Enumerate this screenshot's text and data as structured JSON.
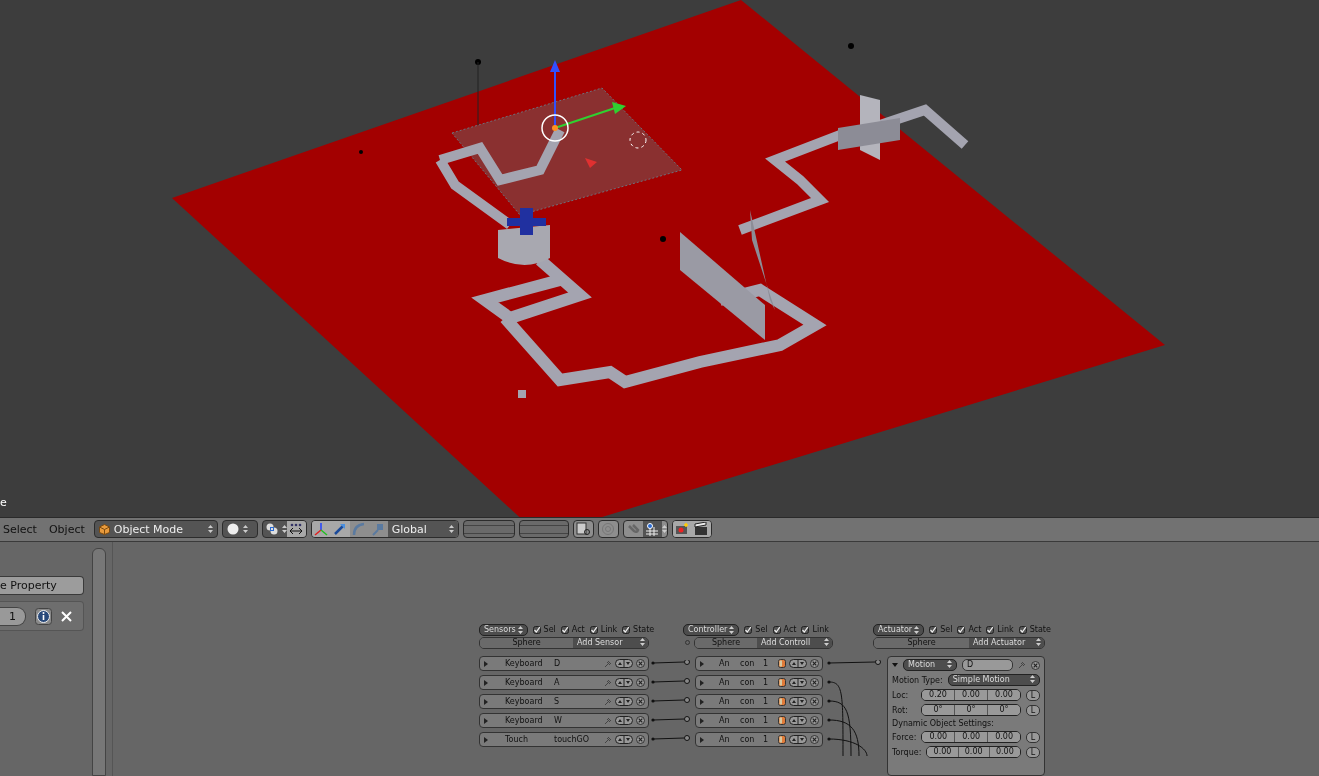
{
  "viewport": {
    "corner_text": "e"
  },
  "header": {
    "menus": [
      "Select",
      "Object"
    ],
    "mode": "Object Mode",
    "orientation": "Global"
  },
  "left_panel": {
    "button": "e Property",
    "field": "1"
  },
  "logic": {
    "sensors": {
      "menu": "Sensors",
      "filters": [
        {
          "label": "Sel",
          "checked": true
        },
        {
          "label": "Act",
          "checked": true
        },
        {
          "label": "Link",
          "checked": true
        },
        {
          "label": "State",
          "checked": true
        }
      ],
      "object": "Sphere",
      "add": "Add Sensor",
      "bricks": [
        {
          "type": "Keyboard",
          "name": "D",
          "expanded": false
        },
        {
          "type": "Keyboard",
          "name": "A",
          "expanded": false
        },
        {
          "type": "Keyboard",
          "name": "S",
          "expanded": false
        },
        {
          "type": "Keyboard",
          "name": "W",
          "expanded": false
        },
        {
          "type": "Touch",
          "name": "touchGO",
          "expanded": false
        }
      ]
    },
    "controllers": {
      "menu": "Controller",
      "filters": [
        {
          "label": "Sel",
          "checked": true
        },
        {
          "label": "Act",
          "checked": true
        },
        {
          "label": "Link",
          "checked": true
        }
      ],
      "object": "Sphere",
      "add": "Add Controll",
      "bricks": [
        {
          "type": "An",
          "name": "con",
          "index": "1",
          "expanded": false
        },
        {
          "type": "An",
          "name": "con",
          "index": "1",
          "expanded": false
        },
        {
          "type": "An",
          "name": "con",
          "index": "1",
          "expanded": false
        },
        {
          "type": "An",
          "name": "con",
          "index": "1",
          "expanded": false
        },
        {
          "type": "An",
          "name": "con",
          "index": "1",
          "expanded": false
        }
      ]
    },
    "actuators": {
      "menu": "Actuator",
      "filters": [
        {
          "label": "Sel",
          "checked": true
        },
        {
          "label": "Act",
          "checked": true
        },
        {
          "label": "Link",
          "checked": true
        },
        {
          "label": "State",
          "checked": true
        }
      ],
      "object": "Sphere",
      "add": "Add Actuator",
      "brick": {
        "type": "Motion",
        "name": "D",
        "expanded": true,
        "motion_type_label": "Motion Type:",
        "motion_type": "Simple Motion",
        "rows": [
          {
            "label": "Loc:",
            "values": [
              "0.20",
              "0.00",
              "0.00"
            ],
            "local": "L"
          },
          {
            "label": "Rot:",
            "values": [
              "0°",
              "0°",
              "0°"
            ],
            "local": "L"
          }
        ],
        "section": "Dynamic Object Settings:",
        "dynamic_rows": [
          {
            "label": "Force:",
            "values": [
              "0.00",
              "0.00",
              "0.00"
            ],
            "local": "L"
          },
          {
            "label": "Torque:",
            "values": [
              "0.00",
              "0.00",
              "0.00"
            ],
            "local": "L"
          }
        ]
      }
    }
  }
}
